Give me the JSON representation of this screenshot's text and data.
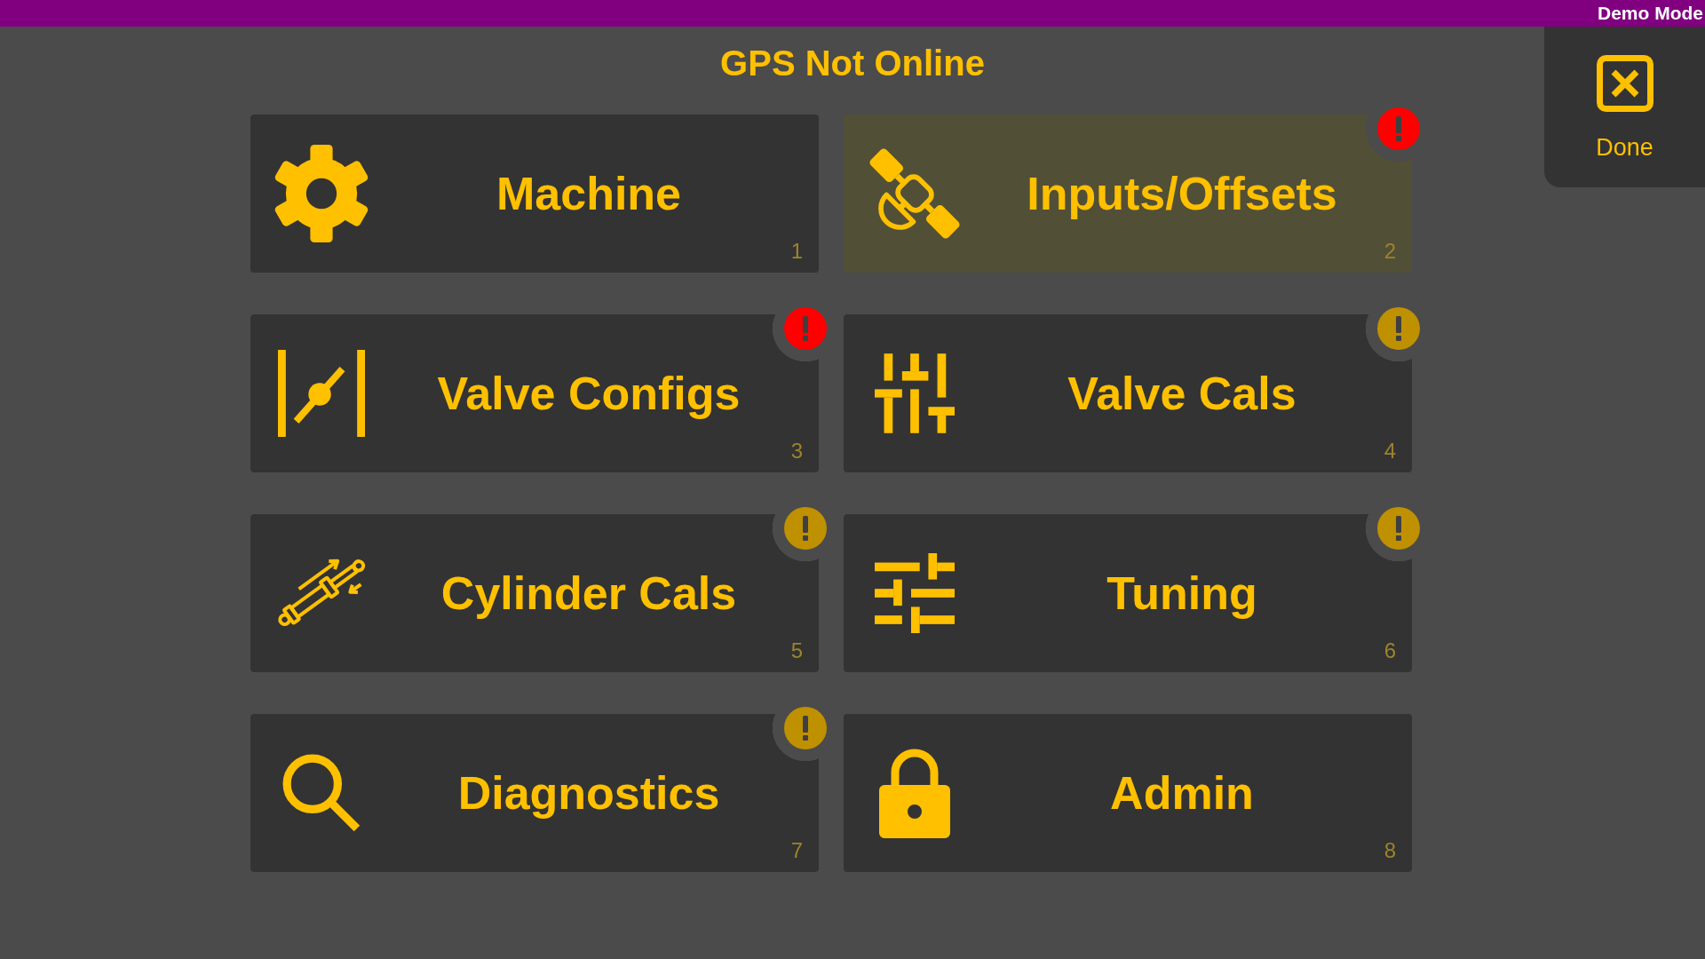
{
  "top_bar": {
    "mode_label": "Demo Mode"
  },
  "title": "GPS Not Online",
  "done_button": {
    "label": "Done"
  },
  "tiles": [
    {
      "label": "Machine",
      "number": "1",
      "selected": false
    },
    {
      "label": "Inputs/Offsets",
      "number": "2",
      "selected": true,
      "badge": {
        "color": "#ff0000"
      }
    },
    {
      "label": "Valve Configs",
      "number": "3",
      "selected": false,
      "badge": {
        "color": "#ff0000"
      }
    },
    {
      "label": "Valve Cals",
      "number": "4",
      "selected": false,
      "badge": {
        "color": "#bf9000"
      }
    },
    {
      "label": "Cylinder Cals",
      "number": "5",
      "selected": false,
      "badge": {
        "color": "#bf9000"
      }
    },
    {
      "label": "Tuning",
      "number": "6",
      "selected": false,
      "badge": {
        "color": "#bf9000"
      }
    },
    {
      "label": "Diagnostics",
      "number": "7",
      "selected": false,
      "badge": {
        "color": "#bf9000"
      }
    },
    {
      "label": "Admin",
      "number": "8",
      "selected": false
    }
  ]
}
